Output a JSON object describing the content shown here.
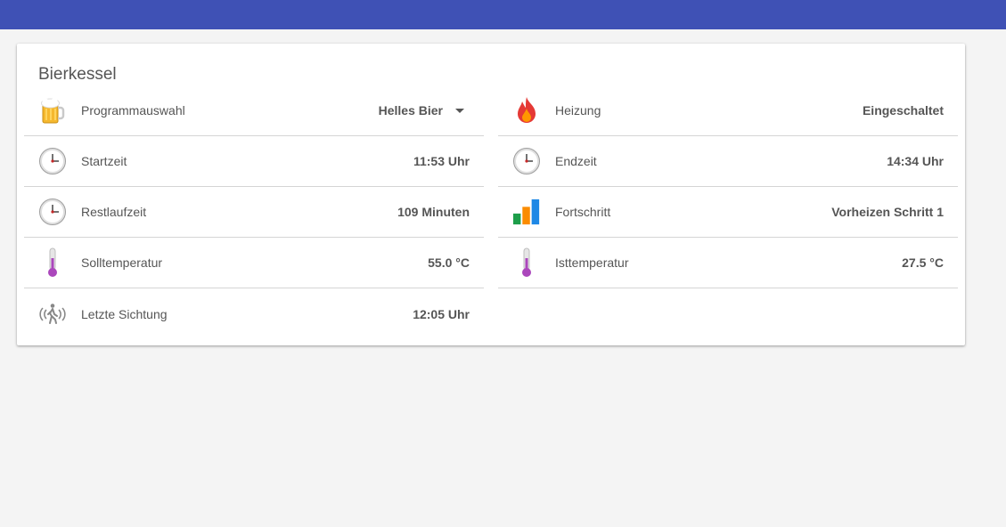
{
  "card": {
    "title": "Bierkessel"
  },
  "left": [
    {
      "icon": "beer-mug-icon",
      "label": "Programmauswahl",
      "value": "Helles Bier",
      "type": "select"
    },
    {
      "icon": "clock-icon",
      "label": "Startzeit",
      "value": "11:53 Uhr"
    },
    {
      "icon": "clock-icon",
      "label": "Restlaufzeit",
      "value": "109 Minuten"
    },
    {
      "icon": "thermometer-icon",
      "label": "Solltemperatur",
      "value": "55.0 °C"
    },
    {
      "icon": "motion-sensor-icon",
      "label": "Letzte Sichtung",
      "value": "12:05 Uhr"
    }
  ],
  "right": [
    {
      "icon": "fire-icon",
      "label": "Heizung",
      "value": "Eingeschaltet"
    },
    {
      "icon": "clock-icon",
      "label": "Endzeit",
      "value": "14:34 Uhr"
    },
    {
      "icon": "bar-chart-icon",
      "label": "Fortschritt",
      "value": "Vorheizen Schritt 1"
    },
    {
      "icon": "thermometer-icon",
      "label": "Isttemperatur",
      "value": "27.5 °C"
    }
  ],
  "colors": {
    "header": "#3f51b5",
    "background": "#f4f4f4",
    "card": "#ffffff"
  }
}
